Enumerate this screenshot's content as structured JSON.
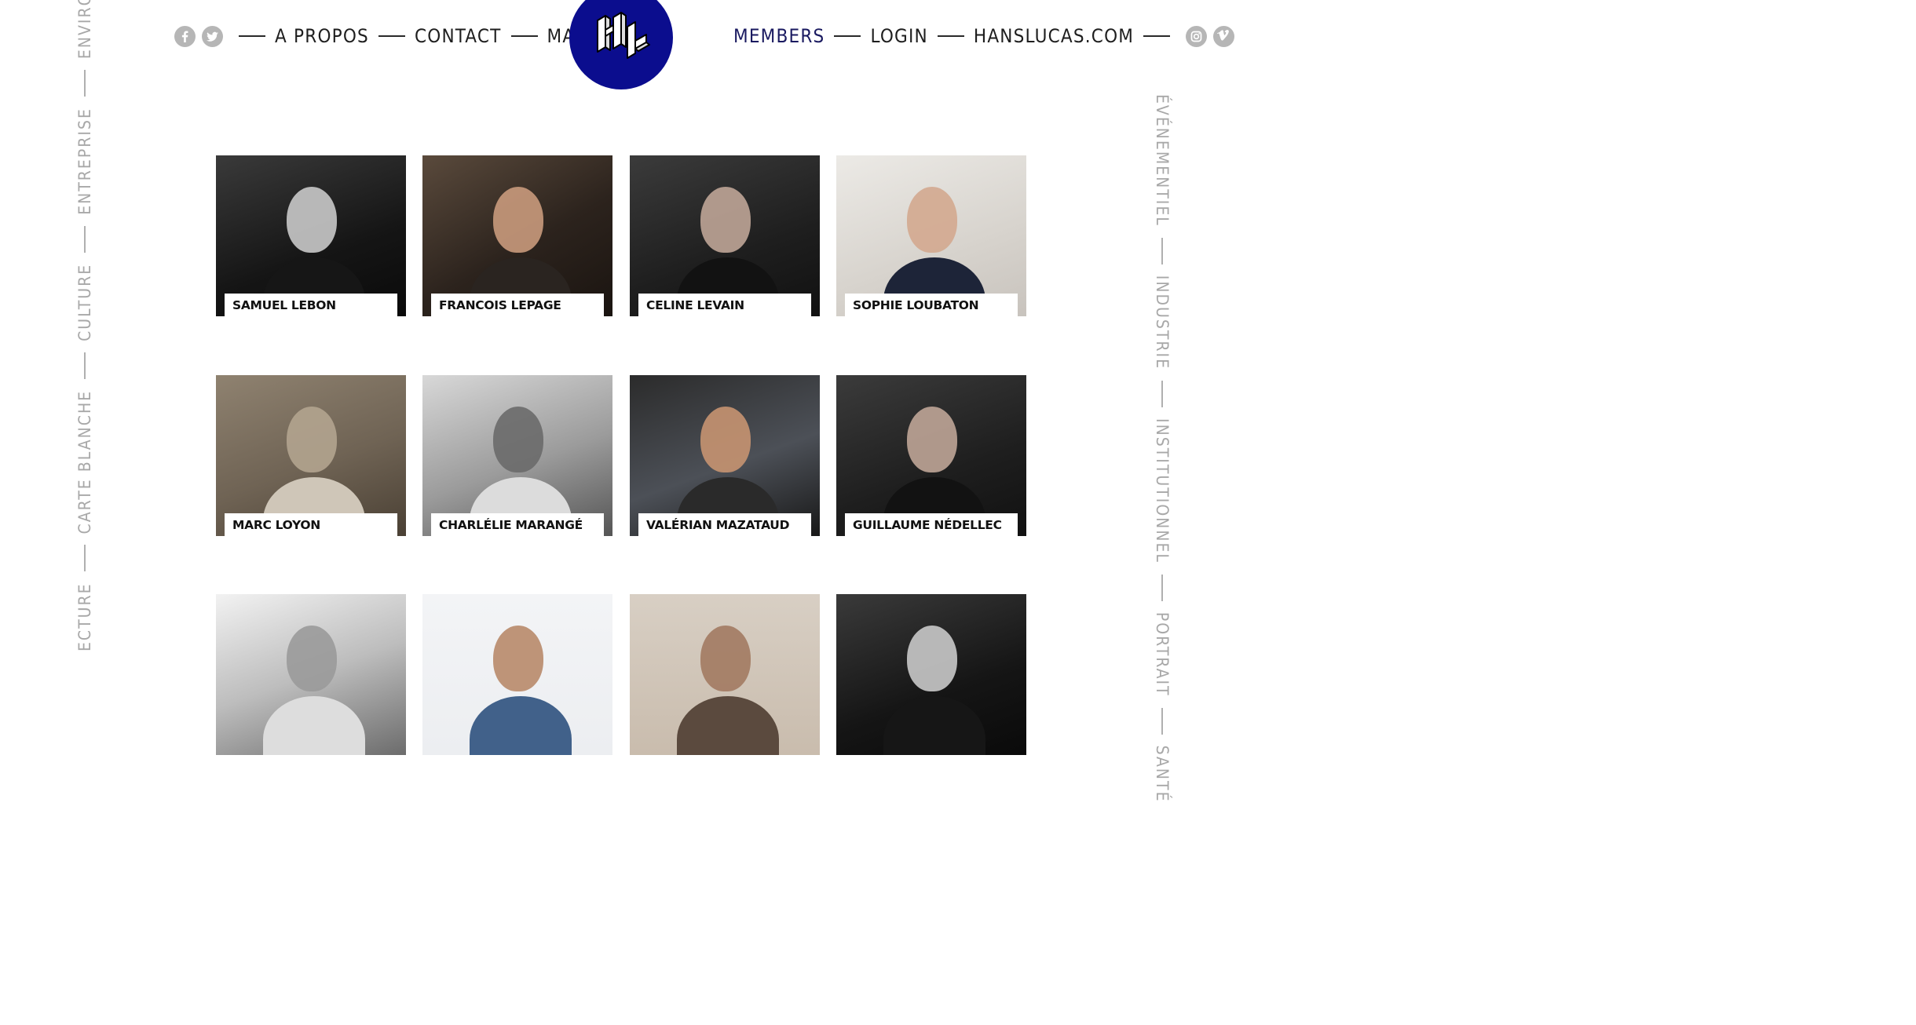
{
  "nav": {
    "left_social": [
      {
        "icon": "facebook-icon",
        "glyph": "f"
      },
      {
        "icon": "twitter-icon",
        "glyph": "t"
      }
    ],
    "left_links": [
      "A PROPOS",
      "CONTACT",
      "MAP"
    ],
    "right_links": [
      "MEMBERS",
      "LOGIN",
      "HANSLUCAS.COM"
    ],
    "active": "MEMBERS",
    "right_social": [
      {
        "icon": "instagram-icon"
      },
      {
        "icon": "vimeo-icon",
        "glyph": "v"
      }
    ]
  },
  "logo": {
    "text": "HL",
    "color": "#0b0d8e"
  },
  "side_left": [
    "ECTURE",
    "CARTE BLANCHE",
    "CULTURE",
    "ENTREPRISE",
    "ENVIRONNEMENT"
  ],
  "side_right": [
    "ÉVÉNEMENTIEL",
    "INDUSTRIE",
    "INSTITUTIONNEL",
    "PORTRAIT",
    "SANTÉ"
  ],
  "members": [
    {
      "name": "SAMUEL LEBON",
      "tone": "bw"
    },
    {
      "name": "FRANCOIS LEPAGE",
      "tone": "warm"
    },
    {
      "name": "CELINE LEVAIN",
      "tone": "dark"
    },
    {
      "name": "SOPHIE LOUBATON",
      "tone": "light"
    },
    {
      "name": "MARC LOYON",
      "tone": "sepia"
    },
    {
      "name": "CHARLÉLIE MARANGÉ",
      "tone": "grey"
    },
    {
      "name": "VALÉRIAN MAZATAUD",
      "tone": "color"
    },
    {
      "name": "GUILLAUME NÉDELLEC",
      "tone": "dark"
    },
    {
      "name": "",
      "tone": "pale"
    },
    {
      "name": "",
      "tone": "white"
    },
    {
      "name": "",
      "tone": "beige"
    },
    {
      "name": "",
      "tone": "bw"
    }
  ],
  "colors": {
    "accent": "#0b0d8e",
    "active_link": "#1a1a60",
    "side_text": "#a8a8a8",
    "social": "#b6b6b6"
  }
}
